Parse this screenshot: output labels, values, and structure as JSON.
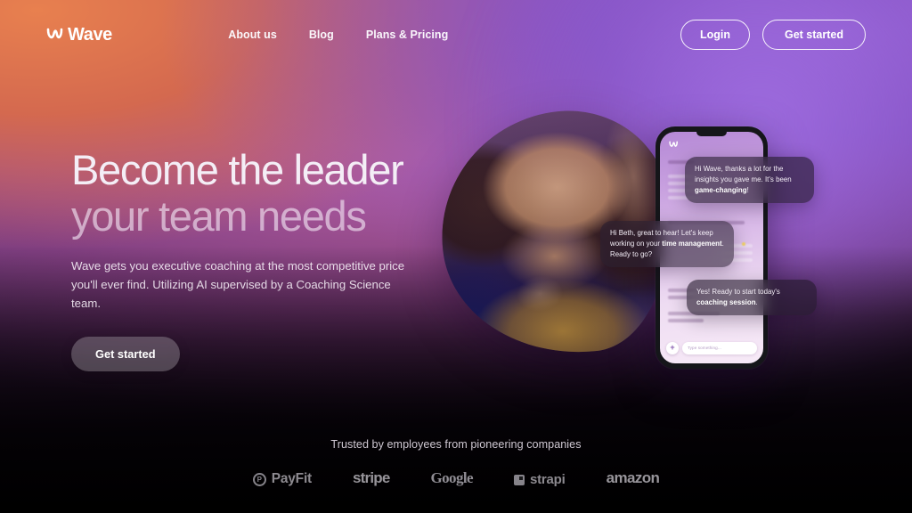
{
  "brand": {
    "name": "Wave",
    "logo_icon": "wave-logo-icon"
  },
  "nav": {
    "items": [
      {
        "label": "About us",
        "name": "nav-item-about-us"
      },
      {
        "label": "Blog",
        "name": "nav-item-blog"
      },
      {
        "label": "Plans & Pricing",
        "name": "nav-item-plans-pricing"
      }
    ],
    "login_label": "Login",
    "get_started_label": "Get started"
  },
  "hero": {
    "headline_line1": "Become the leader",
    "headline_line2": "your team needs",
    "subtitle": "Wave gets you executive coaching at the most competitive price you'll ever find. Utilizing AI supervised by a Coaching Science team.",
    "cta_label": "Get started"
  },
  "phone": {
    "app_logo_icon": "wave-logo-icon",
    "input_placeholder": "Type something...",
    "add_button_label": "+",
    "messages": [
      {
        "name": "chat-bubble-incoming-1",
        "segments": [
          {
            "text": "Hi Wave, thanks a lot for the insights you gave me. It's been ",
            "bold": false
          },
          {
            "text": "game-changing",
            "bold": true
          },
          {
            "text": "!",
            "bold": false
          }
        ]
      },
      {
        "name": "chat-bubble-outgoing-1",
        "segments": [
          {
            "text": "Hi Beth, great to hear! Let's keep working on your ",
            "bold": false
          },
          {
            "text": "time management",
            "bold": true
          },
          {
            "text": ". Ready to go?",
            "bold": false
          }
        ]
      },
      {
        "name": "chat-bubble-incoming-2",
        "segments": [
          {
            "text": "Yes! Ready to start today's ",
            "bold": false
          },
          {
            "text": "coaching session",
            "bold": true
          },
          {
            "text": ".",
            "bold": false
          }
        ]
      }
    ]
  },
  "footer": {
    "trusted_text": "Trusted by employees from pioneering companies",
    "logos": [
      {
        "label": "PayFit",
        "name": "brand-logo-payfit",
        "style": "payfit",
        "mark": "circle",
        "mark_glyph": "P"
      },
      {
        "label": "stripe",
        "name": "brand-logo-stripe",
        "style": "stripe",
        "mark": "none",
        "mark_glyph": ""
      },
      {
        "label": "Google",
        "name": "brand-logo-google",
        "style": "google",
        "mark": "none",
        "mark_glyph": ""
      },
      {
        "label": "strapi",
        "name": "brand-logo-strapi",
        "style": "strapi",
        "mark": "square",
        "mark_glyph": ""
      },
      {
        "label": "amazon",
        "name": "brand-logo-amazon",
        "style": "amazon",
        "mark": "none",
        "mark_glyph": ""
      }
    ]
  },
  "colors": {
    "gradient_warm": "#e8804f",
    "gradient_purple": "#9a66d8",
    "gradient_magenta": "#b45e9e",
    "background_dark": "#050105",
    "text_primary": "#f4eef6",
    "bubble_bg": "#241a2c"
  }
}
